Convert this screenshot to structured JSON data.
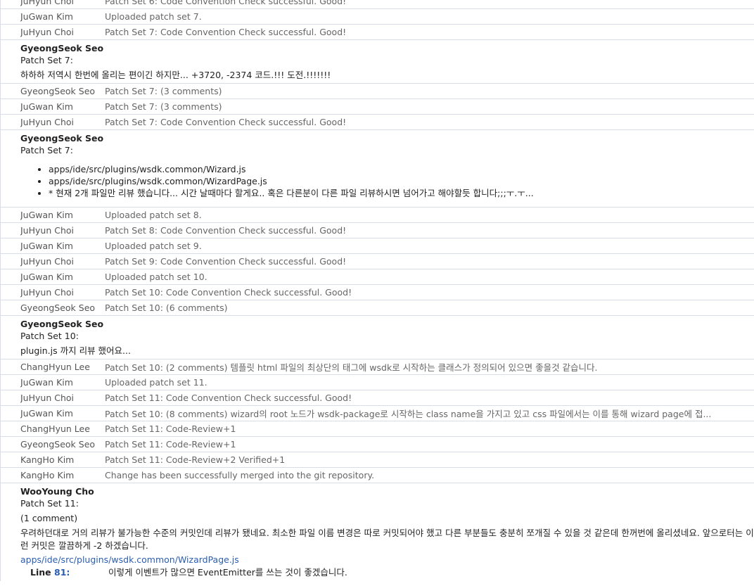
{
  "messages": [
    {
      "type": "row",
      "author": "JuHyun Choi",
      "summary": "Patch Set 6: Code Convention Check successful. Good!"
    },
    {
      "type": "row",
      "author": "JuGwan Kim",
      "summary": "Uploaded patch set 7."
    },
    {
      "type": "row",
      "author": "JuHyun Choi",
      "summary": "Patch Set 7: Code Convention Check successful. Good!"
    },
    {
      "type": "expanded",
      "author": "GyeongSeok Seo",
      "patchset": "Patch Set 7:",
      "text": "하하하 저역시 한번에 올리는 편이긴 하지만... +3720, -2374 코드.!!! 도전.!!!!!!!"
    },
    {
      "type": "row",
      "author": "GyeongSeok Seo",
      "summary": "Patch Set 7: (3 comments)"
    },
    {
      "type": "row",
      "author": "JuGwan Kim",
      "summary": "Patch Set 7: (3 comments)"
    },
    {
      "type": "row",
      "author": "JuHyun Choi",
      "summary": "Patch Set 7: Code Convention Check successful. Good!"
    },
    {
      "type": "expanded_list",
      "author": "GyeongSeok Seo",
      "patchset": "Patch Set 7:",
      "items": [
        "apps/ide/src/plugins/wsdk.common/Wizard.js",
        "apps/ide/src/plugins/wsdk.common/WizardPage.js",
        "* 현재 2개 파일만 리뷰 했습니다... 시간 날때마다 할게요.. 혹은 다른분이 다른 파일 리뷰하시면 넘어가고 해야할듯 합니다;;;ㅜ.ㅜ..."
      ]
    },
    {
      "type": "row",
      "author": "JuGwan Kim",
      "summary": "Uploaded patch set 8."
    },
    {
      "type": "row",
      "author": "JuHyun Choi",
      "summary": "Patch Set 8: Code Convention Check successful. Good!"
    },
    {
      "type": "row",
      "author": "JuGwan Kim",
      "summary": "Uploaded patch set 9."
    },
    {
      "type": "row",
      "author": "JuHyun Choi",
      "summary": "Patch Set 9: Code Convention Check successful. Good!"
    },
    {
      "type": "row",
      "author": "JuGwan Kim",
      "summary": "Uploaded patch set 10."
    },
    {
      "type": "row",
      "author": "JuHyun Choi",
      "summary": "Patch Set 10: Code Convention Check successful. Good!"
    },
    {
      "type": "row",
      "author": "GyeongSeok Seo",
      "summary": "Patch Set 10: (6 comments)"
    },
    {
      "type": "expanded",
      "author": "GyeongSeok Seo",
      "patchset": "Patch Set 10:",
      "text": "plugin.js 까지 리뷰 했어요..."
    },
    {
      "type": "row",
      "author": "ChangHyun Lee",
      "summary": "Patch Set 10: (2 comments) 템플릿 html 파일의 최상단의 태그에 wsdk로 시작하는 클래스가 정의되어 있으면 좋을것 같습니다."
    },
    {
      "type": "row",
      "author": "JuGwan Kim",
      "summary": "Uploaded patch set 11."
    },
    {
      "type": "row",
      "author": "JuHyun Choi",
      "summary": "Patch Set 11: Code Convention Check successful. Good!"
    },
    {
      "type": "row",
      "author": "JuGwan Kim",
      "summary": "Patch Set 10: (8 comments) wizard의 root 노드가 wsdk-package로 시작하는 class name을 가지고 있고 css 파일에서는 이를 통해 wizard page에 접..."
    },
    {
      "type": "row",
      "author": "ChangHyun Lee",
      "summary": "Patch Set 11: Code-Review+1"
    },
    {
      "type": "row",
      "author": "GyeongSeok Seo",
      "summary": "Patch Set 11: Code-Review+1"
    },
    {
      "type": "row",
      "author": "KangHo Kim",
      "summary": "Patch Set 11: Code-Review+2 Verified+1"
    },
    {
      "type": "row",
      "author": "KangHo Kim",
      "summary": "Change has been successfully merged into the git repository."
    },
    {
      "type": "expanded_comment",
      "author": "WooYoung Cho",
      "patchset": "Patch Set 11:",
      "count": "(1 comment)",
      "text": "우려하던대로 거의 리뷰가 불가능한 수준의 커밋인데 리뷰가 됐네요. 최소한 파일 이름 변경은 따로 커밋되어야 했고 다른 부분들도 충분히 쪼개질 수 있을 것 같은데 한꺼번에 올리셨네요. 앞으로터는 이런 커밋은 깔끔하게 -2 하겠습니다.",
      "file": "apps/ide/src/plugins/wsdk.common/WizardPage.js",
      "line_label": "Line",
      "line_number": "81:",
      "comment": "이렇게 이벤트가 많으면 EventEmitter를 쓰는 것이 좋겠습니다."
    }
  ],
  "colors": {
    "link": "#2a5db0",
    "border": "#d8dde8",
    "muted": "#666666"
  }
}
